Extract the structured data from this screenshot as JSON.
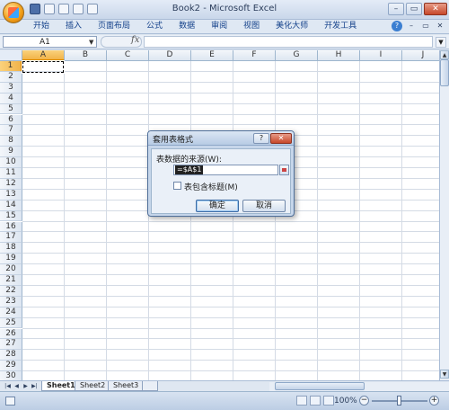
{
  "window": {
    "title": "Book2 - Microsoft Excel"
  },
  "window_controls": {
    "minimize": "–",
    "restore": "▭",
    "close": "✕"
  },
  "ribbon": {
    "tabs": [
      "开始",
      "插入",
      "页面布局",
      "公式",
      "数据",
      "审阅",
      "视图",
      "美化大师",
      "开发工具"
    ],
    "help": "?",
    "sub_controls": {
      "minimize": "–",
      "restore": "▭",
      "close": "✕"
    }
  },
  "formula_bar": {
    "name_box": "A1",
    "fx": "fx",
    "formula": ""
  },
  "grid": {
    "columns": [
      "A",
      "B",
      "C",
      "D",
      "E",
      "F",
      "G",
      "H",
      "I",
      "J"
    ],
    "rows": [
      "1",
      "2",
      "3",
      "4",
      "5",
      "6",
      "7",
      "8",
      "9",
      "10",
      "11",
      "12",
      "13",
      "14",
      "15",
      "16",
      "17",
      "18",
      "19",
      "20",
      "21",
      "22",
      "23",
      "24",
      "25",
      "26",
      "27",
      "28",
      "29",
      "30"
    ],
    "selected_column": "A",
    "selected_row": "1"
  },
  "sheet_tabs": {
    "tabs": [
      "Sheet1",
      "Sheet2",
      "Sheet3"
    ],
    "active": "Sheet1"
  },
  "status_bar": {
    "zoom": "100%"
  },
  "dialog": {
    "title": "套用表格式",
    "help": "?",
    "close": "✕",
    "range_label": "表数据的来源(W):",
    "range_value": "=$A$1",
    "checkbox_label": "表包含标题(M)",
    "checkbox_checked": false,
    "ok_label": "确定",
    "cancel_label": "取消"
  }
}
